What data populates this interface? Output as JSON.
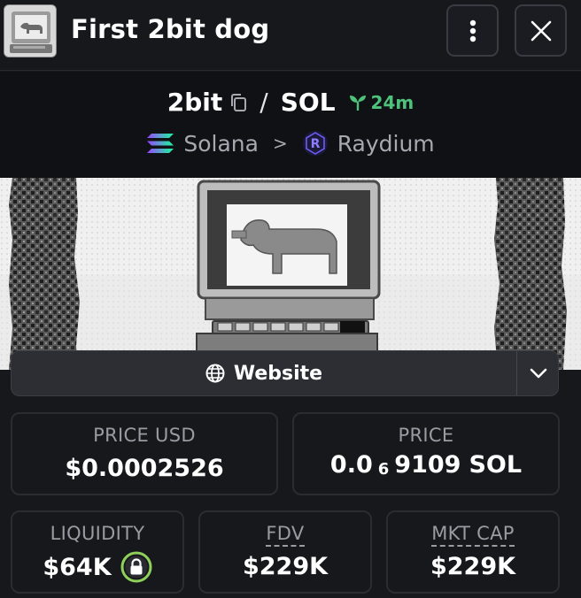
{
  "header": {
    "title": "First 2bit dog",
    "more_icon": "more-vertical-icon",
    "close_icon": "close-icon"
  },
  "pair": {
    "base": "2bit",
    "slash": "/",
    "quote": "SOL",
    "age": "24m",
    "chain": "Solana",
    "dex": "Raydium",
    "separator": ">"
  },
  "links": {
    "website_label": "Website"
  },
  "stats": {
    "price_usd_label": "PRICE USD",
    "price_usd_value": "$0.0002526",
    "price_label": "PRICE",
    "price_prefix": "0.0",
    "price_zeros": "6",
    "price_digits": "9109",
    "price_unit": "SOL",
    "liquidity_label": "LIQUIDITY",
    "liquidity_value": "$64K",
    "fdv_label": "FDV",
    "fdv_value": "$229K",
    "mktcap_label": "MKT CAP",
    "mktcap_value": "$229K"
  },
  "colors": {
    "background": "#17181c",
    "accent_green": "#4ec27a",
    "muted_text": "#9a9ba3"
  }
}
